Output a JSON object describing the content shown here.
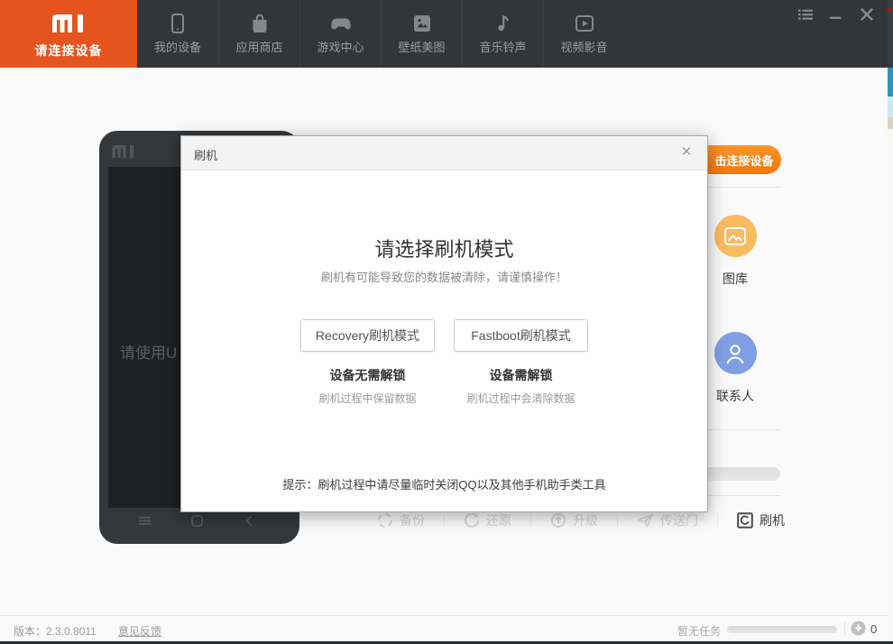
{
  "header": {
    "logo_status": "请连接设备",
    "tabs": [
      {
        "label": "我的设备",
        "icon": "device-icon"
      },
      {
        "label": "应用商店",
        "icon": "store-icon"
      },
      {
        "label": "游戏中心",
        "icon": "game-icon"
      },
      {
        "label": "壁纸美图",
        "icon": "wallpaper-icon"
      },
      {
        "label": "音乐铃声",
        "icon": "music-icon"
      },
      {
        "label": "视频影音",
        "icon": "video-icon"
      }
    ],
    "window_controls": [
      "menu-icon",
      "minimize-icon",
      "close-icon"
    ]
  },
  "phone": {
    "screen_text": "请使用U",
    "nav_icons": [
      "menu-icon",
      "home-icon",
      "back-icon"
    ]
  },
  "dialog": {
    "title": "刷机",
    "close_label": "×",
    "heading": "请选择刷机模式",
    "warning": "刷机有可能导致您的数据被清除，请谨慎操作！",
    "modes": [
      {
        "button": "Recovery刷机模式",
        "subtitle": "设备无需解锁",
        "note": "刷机过程中保留数据"
      },
      {
        "button": "Fastboot刷机模式",
        "subtitle": "设备需解锁",
        "note": "刷机过程中会清除数据"
      }
    ],
    "hint": "提示：刷机过程中请尽量临时关闭QQ以及其他手机助手类工具"
  },
  "side_panel": {
    "connect_button_label": "击连接设备",
    "shortcuts": [
      {
        "label": "图库",
        "icon": "gallery-icon",
        "color": "#f9bb60"
      },
      {
        "label": "联系人",
        "icon": "contacts-icon",
        "color": "#7f9fe5"
      }
    ]
  },
  "toolbar": {
    "items": [
      {
        "label": "备份",
        "icon": "backup-icon",
        "active": false
      },
      {
        "label": "还原",
        "icon": "restore-icon",
        "active": false
      },
      {
        "label": "升级",
        "icon": "upgrade-icon",
        "active": false
      },
      {
        "label": "传送门",
        "icon": "portal-icon",
        "active": false
      },
      {
        "label": "刷机",
        "icon": "flash-icon",
        "active": true
      }
    ]
  },
  "statusbar": {
    "version": "版本：2.3.0.8011",
    "feedback": "意见反馈",
    "task_status": "暂无任务",
    "download_count": "0"
  },
  "colors": {
    "header_bg": "#323639",
    "brand_orange": "#e5531e",
    "connect_button_orange": "#f5760b",
    "gallery_circle": "#f9bb60",
    "contacts_circle": "#7f9fe5"
  }
}
